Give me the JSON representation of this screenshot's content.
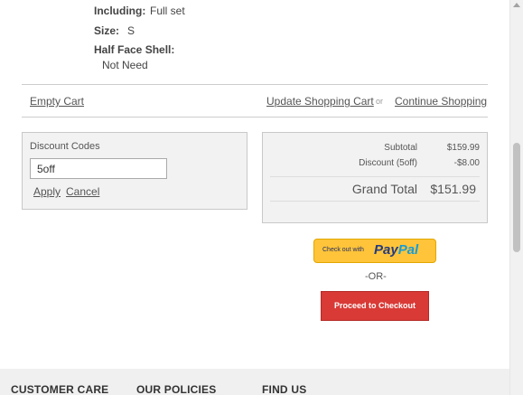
{
  "product_options": {
    "including_label": "Including:",
    "including_value": "Full set",
    "size_label": "Size:",
    "size_value": "S",
    "half_face_label": "Half Face Shell:",
    "half_face_value": "Not Need"
  },
  "cart_actions": {
    "empty_cart": "Empty Cart",
    "update_cart": "Update Shopping Cart",
    "or": "or",
    "continue_shopping": "Continue Shopping"
  },
  "discount": {
    "title": "Discount Codes",
    "input_value": "5off",
    "apply": "Apply",
    "cancel": "Cancel"
  },
  "totals": {
    "subtotal_label": "Subtotal",
    "subtotal_value": "$159.99",
    "discount_label": "Discount (5off)",
    "discount_value": "-$8.00",
    "grand_total_label": "Grand Total",
    "grand_total_value": "$151.99"
  },
  "checkout": {
    "paypal_prefix": "Check out with",
    "paypal_logo_part1": "Pay",
    "paypal_logo_part2": "Pal",
    "or_divider": "-OR-",
    "proceed_label": "Proceed to Checkout"
  },
  "footer": {
    "col1": "CUSTOMER CARE",
    "col2": "OUR POLICIES",
    "col3": "FIND US"
  },
  "colors": {
    "checkout_button": "#d93a36",
    "paypal_button": "#ffc439",
    "paypal_dark": "#253b80",
    "paypal_light": "#179bd7"
  }
}
